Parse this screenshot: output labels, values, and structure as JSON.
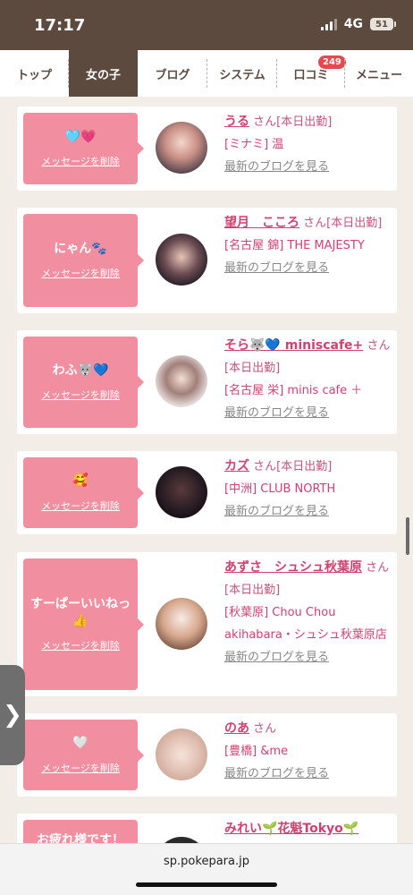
{
  "status": {
    "time": "17:17",
    "network": "4G",
    "battery": "51"
  },
  "tabs": [
    {
      "label": "トップ",
      "active": false
    },
    {
      "label": "女の子",
      "active": true
    },
    {
      "label": "ブログ",
      "active": false
    },
    {
      "label": "システム",
      "active": false
    },
    {
      "label": "口コミ",
      "active": false,
      "badge": "249"
    },
    {
      "label": "メニュー",
      "active": false
    }
  ],
  "entries": [
    {
      "message": "🩵💗",
      "delete_label": "メッセージを削除",
      "name": "うる",
      "suffix": "さん[本日出勤]",
      "shop": "[ミナミ] 温",
      "blog_link": "最新のブログを見る"
    },
    {
      "message": "にゃん🐾",
      "delete_label": "メッセージを削除",
      "name": "望月　こころ",
      "suffix": "さん[本日出勤]",
      "shop": "[名古屋 錦] THE MAJESTY",
      "blog_link": "最新のブログを見る"
    },
    {
      "message": "わふ🐺💙",
      "delete_label": "メッセージを削除",
      "name": "そら🐺💙 miniscafe+",
      "suffix": "さん[本日出勤]",
      "shop": "[名古屋 栄] minis cafe ＋",
      "blog_link": "最新のブログを見る"
    },
    {
      "message": "🥰",
      "delete_label": "メッセージを削除",
      "name": "カズ",
      "suffix": "さん[本日出勤]",
      "shop": "[中洲] CLUB NORTH",
      "blog_link": "最新のブログを見る"
    },
    {
      "message": "すーぱーいいねっ👍",
      "delete_label": "メッセージを削除",
      "name": "あずさ　シュシュ秋葉原",
      "suffix": "さん[本日出勤]",
      "shop": "[秋葉原] Chou Chou akihabara・シュシュ秋葉原店",
      "blog_link": "最新のブログを見る"
    },
    {
      "message": "🤍",
      "delete_label": "メッセージを削除",
      "name": "のあ",
      "suffix": "さん",
      "shop": "[豊橋] &me",
      "blog_link": "最新のブログを見る"
    },
    {
      "message": "お疲れ様です！",
      "delete_label": "メッセージを削除",
      "name": "みれい🌱花魁Tokyo🌱",
      "suffix": "",
      "shop": "",
      "blog_link": ""
    }
  ],
  "side_tab_icon": "chevron-right-icon",
  "url": "sp.pokepara.jp",
  "colors": {
    "header": "#5d4a3e",
    "accent": "#d1416f",
    "bubble": "#f18ea0",
    "badge": "#e8474f"
  }
}
